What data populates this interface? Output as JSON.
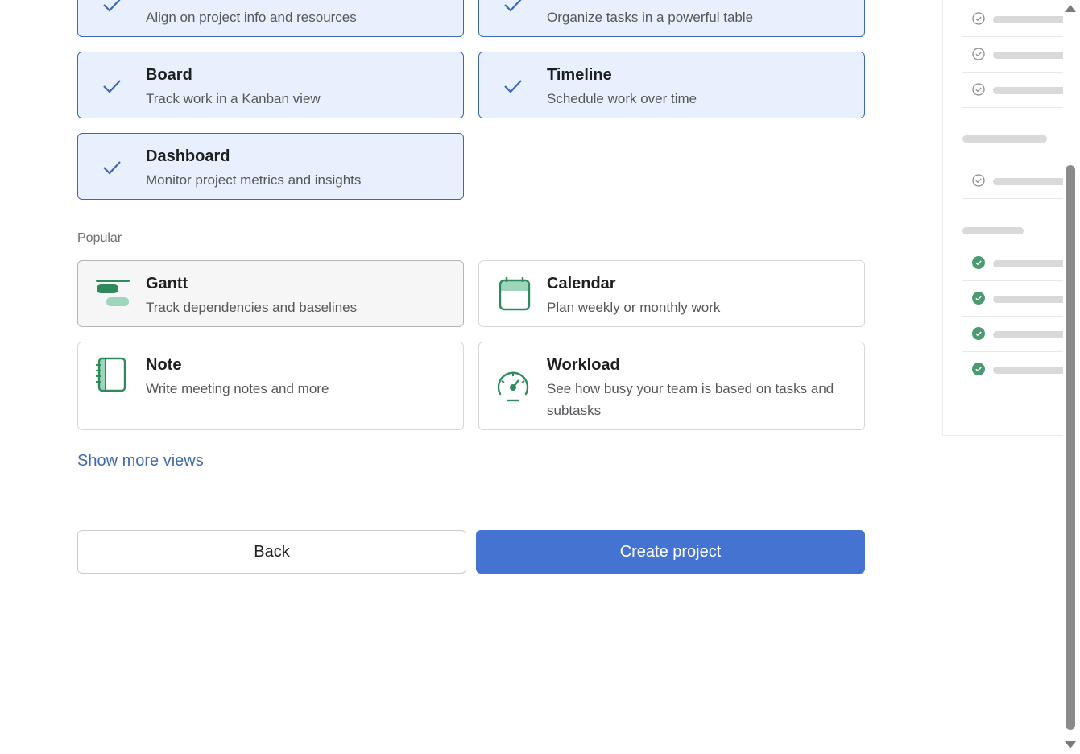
{
  "selected_views": [
    {
      "title": "",
      "desc": "Align on project info and resources"
    },
    {
      "title": "",
      "desc": "Organize tasks in a powerful table"
    },
    {
      "title": "Board",
      "desc": "Track work in a Kanban view"
    },
    {
      "title": "Timeline",
      "desc": "Schedule work over time"
    },
    {
      "title": "Dashboard",
      "desc": "Monitor project metrics and insights"
    }
  ],
  "popular": {
    "label": "Popular",
    "items": [
      {
        "title": "Gantt",
        "desc": "Track dependencies and baselines",
        "icon": "gantt-icon"
      },
      {
        "title": "Calendar",
        "desc": "Plan weekly or monthly work",
        "icon": "calendar-icon"
      },
      {
        "title": "Note",
        "desc": "Write meeting notes and more",
        "icon": "note-icon"
      },
      {
        "title": "Workload",
        "desc": "See how busy your team is based on tasks and subtasks",
        "icon": "workload-gauge-icon"
      }
    ]
  },
  "show_more": "Show more views",
  "buttons": {
    "back": "Back",
    "create": "Create project"
  },
  "colors": {
    "accent": "#4573d2",
    "selected_bg": "#e8f0fd",
    "selected_border": "#3a67b9",
    "icon_green": "#2e8a5c",
    "icon_light_green": "#9fd6bb"
  }
}
